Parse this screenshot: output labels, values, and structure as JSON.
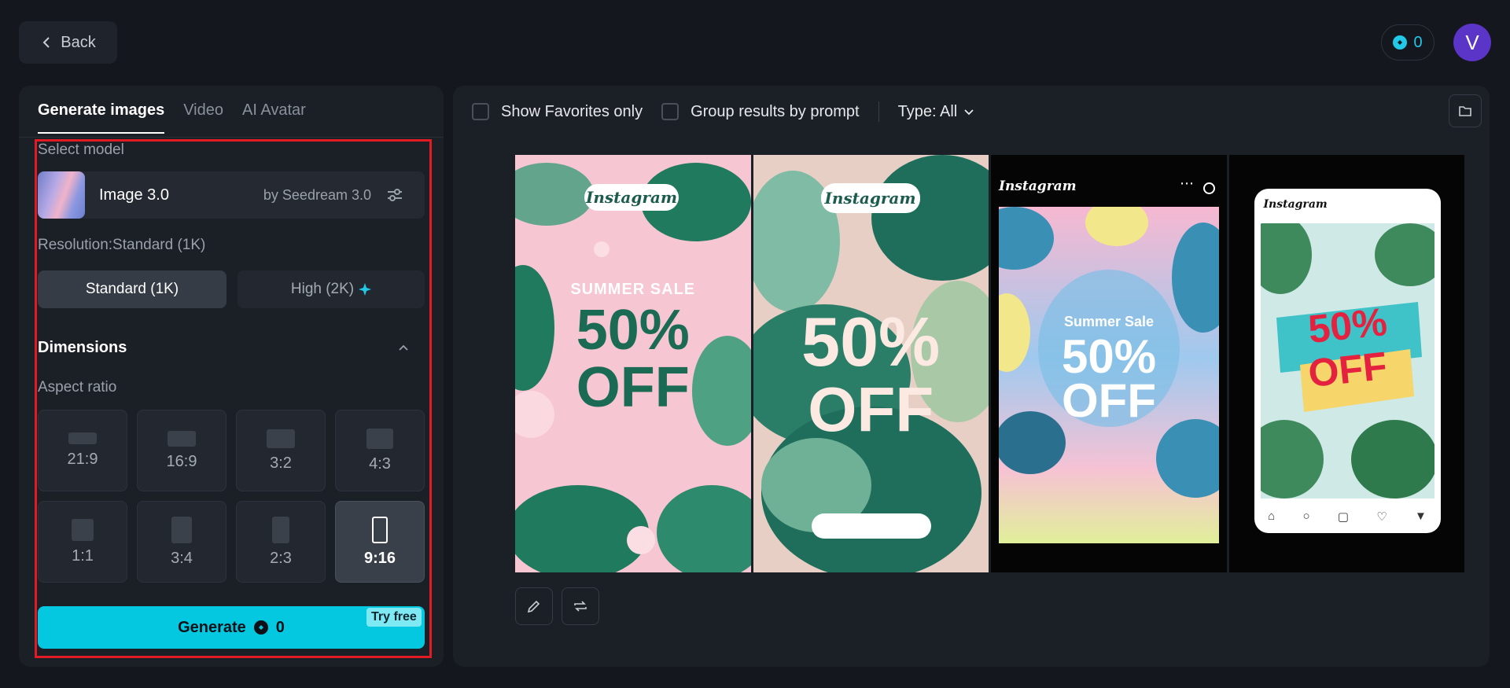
{
  "header": {
    "back_label": "Back",
    "credits": "0",
    "avatar_initial": "V"
  },
  "tabs": [
    {
      "label": "Generate images",
      "active": true
    },
    {
      "label": "Video",
      "active": false
    },
    {
      "label": "AI Avatar",
      "active": false
    }
  ],
  "model": {
    "section_label": "Select model",
    "name": "Image 3.0",
    "by": "by Seedream 3.0"
  },
  "resolution": {
    "label": "Resolution:Standard (1K)",
    "options": [
      "Standard (1K)",
      "High (2K)"
    ],
    "selected": "Standard (1K)"
  },
  "dimensions": {
    "title": "Dimensions",
    "aspect_label": "Aspect ratio",
    "options": [
      "21:9",
      "16:9",
      "3:2",
      "4:3",
      "1:1",
      "3:4",
      "2:3",
      "9:16"
    ],
    "selected": "9:16"
  },
  "generate": {
    "label": "Generate",
    "cost": "0",
    "badge": "Try free"
  },
  "filters": {
    "favorites": "Show Favorites only",
    "group": "Group results by prompt",
    "type": "Type: All"
  },
  "images": [
    {
      "brand": "Instagram",
      "line1": "SUMMER SALE",
      "line2": "50%",
      "line3": "OFF"
    },
    {
      "brand": "Instagram",
      "line2": "50%",
      "line3": "OFF"
    },
    {
      "brand": "Instagram",
      "line1": "Summer Sale",
      "line2": "50%",
      "line3": "OFF"
    },
    {
      "brand": "Instagram",
      "line2": "50%",
      "line3": "OFF"
    }
  ],
  "colors": {
    "accent": "#04c8e0",
    "highlight": "#e01b24",
    "avatar": "#5b34c8"
  }
}
